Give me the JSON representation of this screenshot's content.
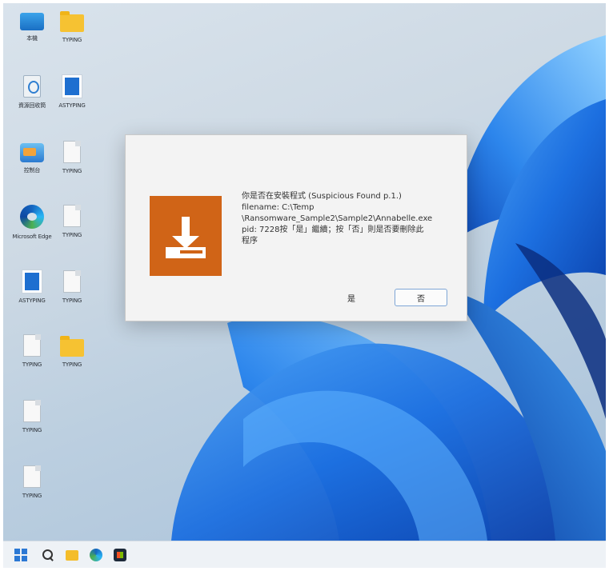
{
  "desktop": {
    "icons": [
      {
        "label": "本機",
        "icon": "monitor-icon"
      },
      {
        "label": "TYPING",
        "icon": "folder-icon"
      },
      {
        "label": "資源回收筒",
        "icon": "recycle-bin-icon"
      },
      {
        "label": "ASTYPING",
        "icon": "document-icon"
      },
      {
        "label": "控制台",
        "icon": "control-panel-icon"
      },
      {
        "label": "TYPING",
        "icon": "file-icon"
      },
      {
        "label": "Microsoft Edge",
        "icon": "edge-icon"
      },
      {
        "label": "TYPING",
        "icon": "file-icon"
      },
      {
        "label": "ASTYPING",
        "icon": "document-icon"
      },
      {
        "label": "TYPING",
        "icon": "file-icon"
      },
      {
        "label": "TYPING",
        "icon": "file-icon"
      },
      {
        "label": "TYPING",
        "icon": "folder-icon"
      },
      {
        "label": "TYPING",
        "icon": "file-icon"
      },
      {
        "label": "TYPING",
        "icon": "file-icon"
      }
    ]
  },
  "dialog": {
    "title": "",
    "icon": "download-icon",
    "icon_color": "#d06417",
    "message_lines": [
      "你是否在安裝程式 (Suspicious Found p.1.)",
      "filename: C:\\Temp",
      "\\Ransomware_Sample2\\Sample2\\Annabelle.exe",
      "pid: 7228按「是」繼續；按「否」則是否要刪除此",
      "程序"
    ],
    "yes_label": "是",
    "no_label": "否"
  },
  "taskbar": {
    "items": [
      "start-icon",
      "search-icon",
      "file-explorer-icon",
      "edge-icon",
      "store-icon"
    ]
  },
  "colors": {
    "accent": "#2b78d4",
    "dialog_icon": "#d06417"
  }
}
